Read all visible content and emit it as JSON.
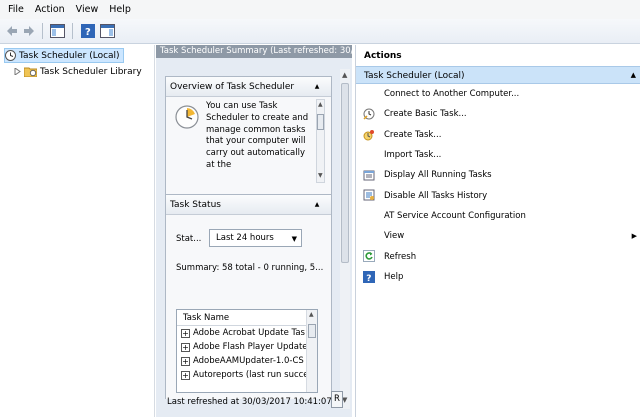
{
  "menu": [
    "File",
    "Action",
    "View",
    "Help"
  ],
  "tree": {
    "root": "Task Scheduler (Local)",
    "library": "Task Scheduler Library"
  },
  "middle": {
    "header": "Task Scheduler Summary (Last refreshed: 30/",
    "overview": {
      "title": "Overview of Task Scheduler",
      "text": "You can use Task Scheduler to create and manage common tasks that your computer will carry out automatically at the"
    },
    "status": {
      "title": "Task Status",
      "stat_label": "Stat...",
      "select_value": "Last 24 hours",
      "summary": "Summary: 58 total - 0 running, 5...",
      "task_list_header": "Task Name",
      "tasks": [
        "Adobe Acrobat Update Tas",
        "Adobe Flash Player Updater",
        "AdobeAAMUpdater-1.0-CS",
        "Autoreports (last run succe"
      ]
    },
    "last_refreshed": "Last refreshed at 30/03/2017 10:41:07",
    "refresh_button": "R"
  },
  "actions": {
    "title": "Actions",
    "group": "Task Scheduler (Local)",
    "items": [
      {
        "label": "Connect to Another Computer...",
        "icon": "none"
      },
      {
        "label": "Create Basic Task...",
        "icon": "clock-wand-icon"
      },
      {
        "label": "Create Task...",
        "icon": "task-star-icon"
      },
      {
        "label": "Import Task...",
        "icon": "none"
      },
      {
        "label": "Display All Running Tasks",
        "icon": "running-tasks-icon"
      },
      {
        "label": "Disable All Tasks History",
        "icon": "history-icon"
      },
      {
        "label": "AT Service Account Configuration",
        "icon": "none"
      },
      {
        "label": "View",
        "icon": "none",
        "submenu": true
      },
      {
        "label": "Refresh",
        "icon": "refresh-icon"
      },
      {
        "label": "Help",
        "icon": "help-icon"
      }
    ]
  },
  "colors": {
    "selection": "#cce6ff",
    "group_header": "#cbe3f9",
    "middle_header": "#8e99a6",
    "middle_bg": "#e5ebf3"
  }
}
